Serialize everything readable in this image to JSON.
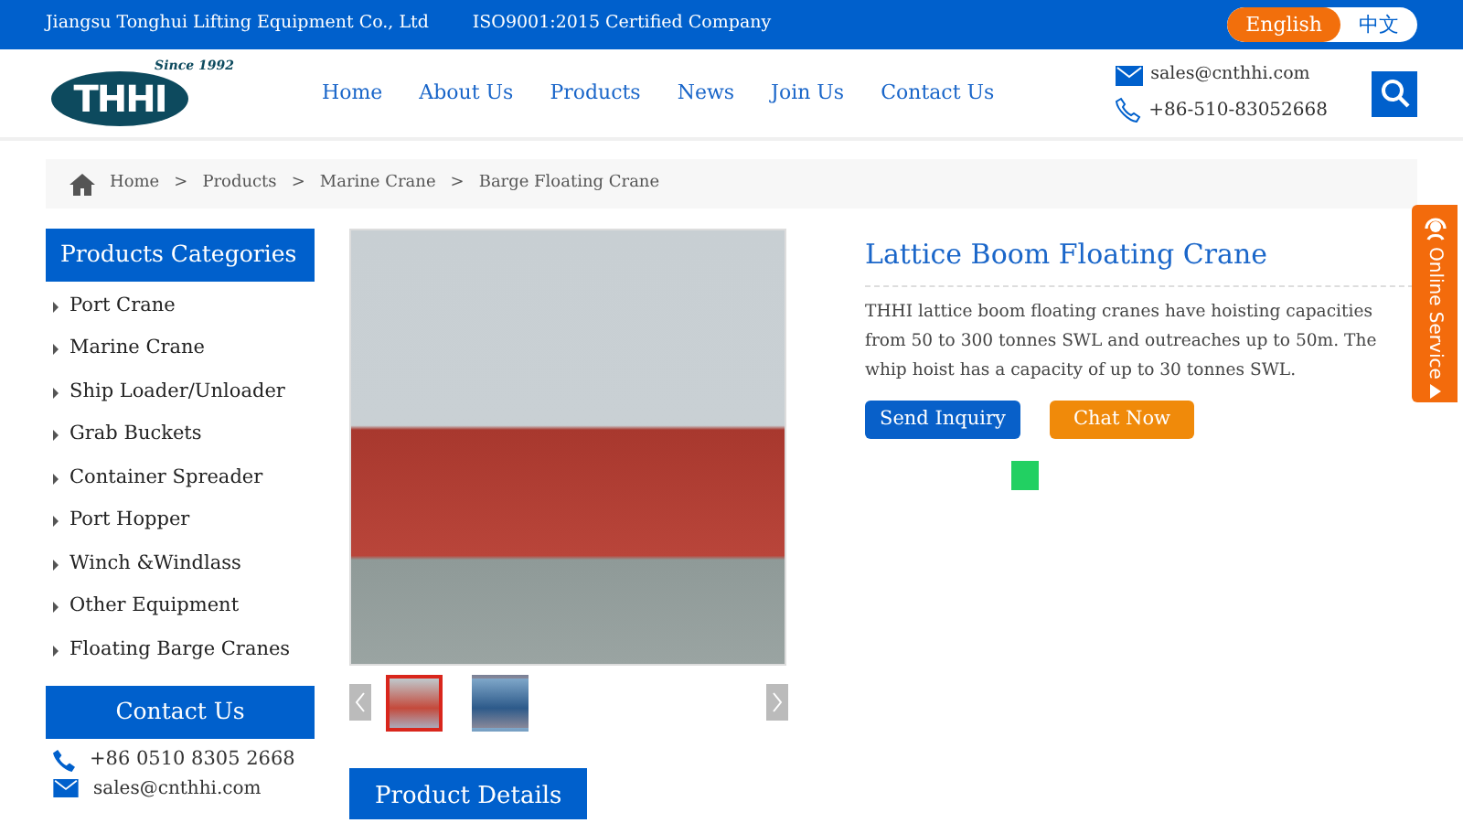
{
  "top_bar": {
    "company": "Jiangsu Tonghui Lifting Equipment Co., Ltd",
    "certification": "ISO9001:2015 Certified Company",
    "languages": [
      {
        "label": "English",
        "selected": true
      },
      {
        "label": "中文",
        "selected": false
      }
    ]
  },
  "header": {
    "logo": {
      "text": "THHI",
      "tagline": "Since 1992"
    },
    "nav": [
      "Home",
      "About Us",
      "Products",
      "News",
      "Join Us",
      "Contact Us"
    ],
    "email": "sales@cnthhi.com",
    "phone": "+86-510-83052668"
  },
  "breadcrumb": {
    "separator": ">",
    "items": [
      "Home",
      "Products",
      "Marine Crane",
      "Barge Floating Crane"
    ]
  },
  "sidebar": {
    "title": "Products Categories",
    "items": [
      "Port Crane",
      "Marine Crane",
      "Ship Loader/Unloader",
      "Grab Buckets",
      "Container Spreader",
      "Port Hopper",
      "Winch &Windlass",
      "Other Equipment",
      "Floating Barge Cranes"
    ],
    "contact_title": "Contact Us",
    "phone": "+86 0510 8305 2668",
    "email": "sales@cnthhi.com"
  },
  "gallery": {
    "thumbnails": [
      {
        "selected": true
      },
      {
        "selected": false
      }
    ]
  },
  "product": {
    "title": "Lattice Boom Floating Crane",
    "description": "THHI lattice boom floating cranes have hoisting capacities from 50 to 300 tonnes SWL and outreaches up to 50m. The whip hoist has a capacity of up to 30 tonnes SWL.",
    "buttons": [
      {
        "label": "Send Inquiry",
        "kind": "primary"
      },
      {
        "label": "Chat Now",
        "kind": "chat"
      }
    ]
  },
  "details_tab": "Product Details",
  "online_service": "Online Service"
}
